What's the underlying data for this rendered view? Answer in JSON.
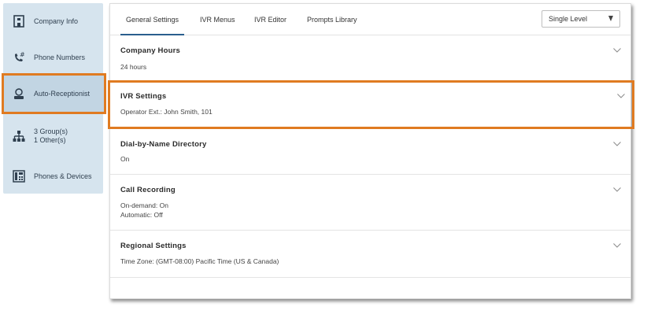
{
  "sidebar": {
    "items": [
      {
        "label": "Company Info",
        "icon": "building-icon"
      },
      {
        "label": "Phone Numbers",
        "icon": "phone-hash-icon"
      },
      {
        "label": "Auto-Receptionist",
        "icon": "receptionist-icon"
      },
      {
        "label_lines": [
          "3 Group(s)",
          "1 Other(s)"
        ],
        "icon": "org-chart-icon"
      },
      {
        "label": "Phones & Devices",
        "icon": "desk-phone-icon"
      }
    ],
    "active_index": 2
  },
  "tabs": [
    "General Settings",
    "IVR Menus",
    "IVR Editor",
    "Prompts Library"
  ],
  "active_tab": 0,
  "level_select": {
    "value": "Single Level"
  },
  "sections": [
    {
      "title": "Company Hours",
      "lines": [
        "24 hours"
      ]
    },
    {
      "title": "IVR Settings",
      "lines": [
        "Operator Ext.: John Smith, 101"
      ]
    },
    {
      "title": "Dial-by-Name Directory",
      "lines": [
        "On"
      ]
    },
    {
      "title": "Call Recording",
      "lines": [
        "On-demand: On",
        "Automatic: Off"
      ]
    },
    {
      "title": "Regional Settings",
      "lines": [
        "Time Zone: (GMT-08:00) Pacific Time (US & Canada)"
      ]
    }
  ],
  "colors": {
    "highlight": "#e07b21",
    "sidebar_bg": "#d6e4ee",
    "tab_underline": "#2a5f8e"
  }
}
